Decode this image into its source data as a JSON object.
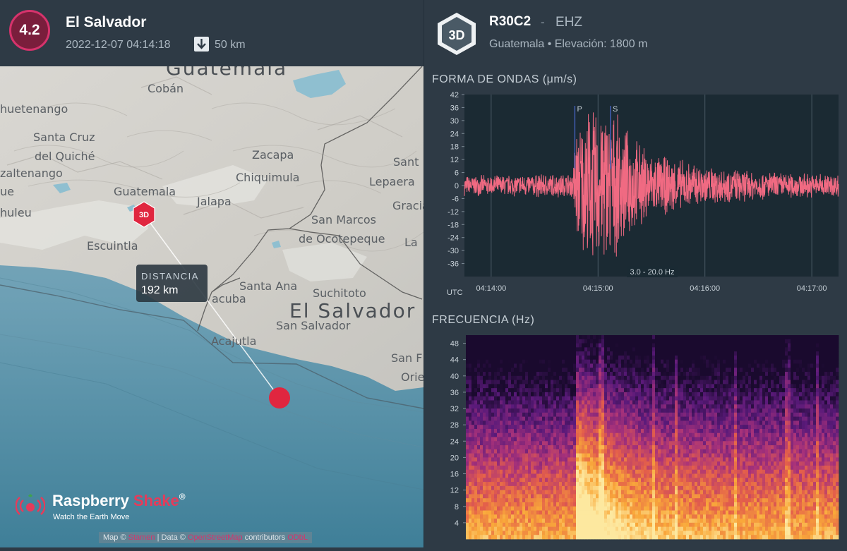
{
  "event": {
    "magnitude": "4.2",
    "title": "El Salvador",
    "datetime": "2022-12-07 04:14:18",
    "depth": "50 km"
  },
  "map": {
    "distance_label": "DISTANCIA",
    "distance_value": "192 km",
    "station_marker": "3D",
    "places": [
      {
        "name": "Guatemala",
        "cls": "big"
      },
      {
        "name": "Cobán"
      },
      {
        "name": "huetenango"
      },
      {
        "name": "Santa Cruz"
      },
      {
        "name": "del Quiché"
      },
      {
        "name": "zaltenango"
      },
      {
        "name": "Zacapa"
      },
      {
        "name": "Chiquimula"
      },
      {
        "name": "Sant"
      },
      {
        "name": "Lepaera"
      },
      {
        "name": "Gracias"
      },
      {
        "name": "Guatemala"
      },
      {
        "name": "Jalapa"
      },
      {
        "name": "San Marcos"
      },
      {
        "name": "de Ocotepeque"
      },
      {
        "name": "La"
      },
      {
        "name": "huleu"
      },
      {
        "name": "ue"
      },
      {
        "name": "Escuintla"
      },
      {
        "name": "Santa Ana"
      },
      {
        "name": "Suchitoto"
      },
      {
        "name": "acuba"
      },
      {
        "name": "El Salvador",
        "cls": "big"
      },
      {
        "name": "San Salvador"
      },
      {
        "name": "Acajutla"
      },
      {
        "name": "San F"
      },
      {
        "name": "Orie"
      }
    ],
    "logo_name_1": "Raspberry ",
    "logo_name_2": "Shake",
    "logo_reg": "®",
    "logo_tagline": "Watch the Earth Move",
    "attribution_prefix": "Map © ",
    "attribution_link1": "Stamen",
    "attribution_mid": " | Data © ",
    "attribution_link2": "OpenStreetMap",
    "attribution_mid2": " contributors ",
    "attribution_link3": "ODbL"
  },
  "station": {
    "badge": "3D",
    "code": "R30C2",
    "separator": "-",
    "channel": "EHZ",
    "location": "Guatemala • Elevación: 1800 m"
  },
  "waveform": {
    "title": "FORMA DE ONDAS (μm/s)",
    "filter_label": "3.0 - 20.0 Hz",
    "time_zone": "UTC",
    "p_label": "P",
    "s_label": "S"
  },
  "spectrogram": {
    "title": "FRECUENCIA (Hz)"
  },
  "colors": {
    "accent": "#d6336c",
    "trace": "#f06a82",
    "event_dot": "#e0263f",
    "panel": "#2e3a45",
    "plot_bg": "#1b2a33"
  },
  "chart_data": [
    {
      "type": "line",
      "title": "FORMA DE ONDAS (μm/s)",
      "xlabel": "UTC",
      "ylabel": "",
      "x_ticks": [
        "04:14:00",
        "04:15:00",
        "04:16:00",
        "04:17:00"
      ],
      "y_ticks": [
        42,
        36,
        30,
        24,
        18,
        12,
        6,
        0,
        -6,
        -12,
        -18,
        -24,
        -30,
        -36
      ],
      "ylim": [
        -42,
        42
      ],
      "series": [
        {
          "values": [
            {
              "t": "04:13:45",
              "amp": 5
            },
            {
              "t": "04:14:00",
              "amp": 5
            },
            {
              "t": "04:14:30",
              "amp": 6
            },
            {
              "t": "04:14:46",
              "amp": 6
            },
            {
              "t": "04:14:47",
              "amp": 28
            },
            {
              "t": "04:14:55",
              "amp": 38
            },
            {
              "t": "04:15:05",
              "amp": 40
            },
            {
              "t": "04:15:15",
              "amp": 28
            },
            {
              "t": "04:15:30",
              "amp": 16
            },
            {
              "t": "04:16:00",
              "amp": 10
            },
            {
              "t": "04:16:30",
              "amp": 7
            },
            {
              "t": "04:17:00",
              "amp": 6
            },
            {
              "t": "04:17:15",
              "amp": 6
            }
          ]
        }
      ],
      "markers": [
        {
          "label": "P",
          "t": "04:14:47"
        },
        {
          "label": "S",
          "t": "04:15:07"
        }
      ],
      "annotation": "3.0 - 20.0 Hz",
      "grid": true
    },
    {
      "type": "heatmap",
      "title": "FRECUENCIA (Hz)",
      "xlabel": "",
      "ylabel": "",
      "y_ticks": [
        48,
        44,
        40,
        36,
        32,
        28,
        24,
        20,
        16,
        12,
        8,
        4
      ],
      "ylim": [
        0,
        50
      ],
      "x_range": [
        "04:13:45",
        "04:17:15"
      ],
      "event_onset": "04:14:47",
      "colormap": [
        "#1a0a2e",
        "#5a1a7a",
        "#a8327a",
        "#e35e4b",
        "#f9a93a",
        "#fde8a0"
      ]
    }
  ]
}
